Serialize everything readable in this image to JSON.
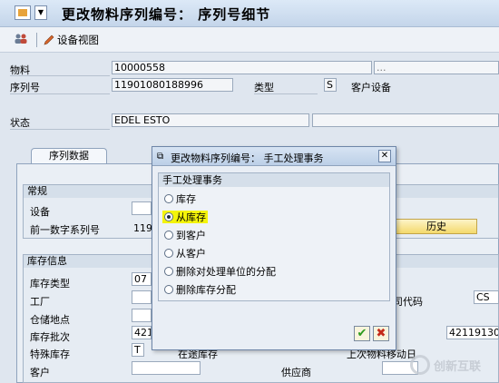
{
  "window": {
    "title": "更改物料序列编号： 序列号细节"
  },
  "toolbar": {
    "equipment_view_label": "设备视图"
  },
  "header": {
    "material_label": "物料",
    "material_value": "10000558",
    "material_desc": "...",
    "serial_label": "序列号",
    "serial_value": "11901080188996",
    "category_label": "类型",
    "category_value": "S",
    "category_desc": "客户设备",
    "status_label": "状态",
    "status_value": "EDEL ESTO"
  },
  "tab": {
    "label": "序列数据"
  },
  "general": {
    "title": "常规",
    "equipment_label": "设备",
    "prev_serial_label": "前一数字系列号",
    "prev_serial_value": "119",
    "history_button": "历史"
  },
  "stock": {
    "title": "库存信息",
    "stock_type_label": "库存类型",
    "stock_type_value": "07",
    "plant_label": "工厂",
    "storage_label": "仓储地点",
    "batch_label": "库存批次",
    "batch_value": "421",
    "batch_right_value": "42119130",
    "company_code_label": "司代码",
    "company_code_value": "CS",
    "special_stock_label": "特殊库存",
    "special_stock_value": "T",
    "special_stock_desc": "在途库存",
    "last_move_label": "上次物料移动日",
    "customer_label": "客户",
    "vendor_label": "供应商"
  },
  "dialog": {
    "title": "更改物料序列编号： 手工处理事务",
    "group_title": "手工处理事务",
    "options": [
      {
        "label": "库存",
        "selected": false
      },
      {
        "label": "从库存",
        "selected": true
      },
      {
        "label": "到客户",
        "selected": false
      },
      {
        "label": "从客户",
        "selected": false
      },
      {
        "label": "删除对处理单位的分配",
        "selected": false
      },
      {
        "label": "删除库存分配",
        "selected": false
      }
    ],
    "confirm_icon": "check-icon",
    "cancel_icon": "cancel-x-icon"
  },
  "watermark": {
    "text": "创新互联"
  },
  "colors": {
    "highlight": "#f4f40a",
    "button_fill": "#f4d96c"
  }
}
